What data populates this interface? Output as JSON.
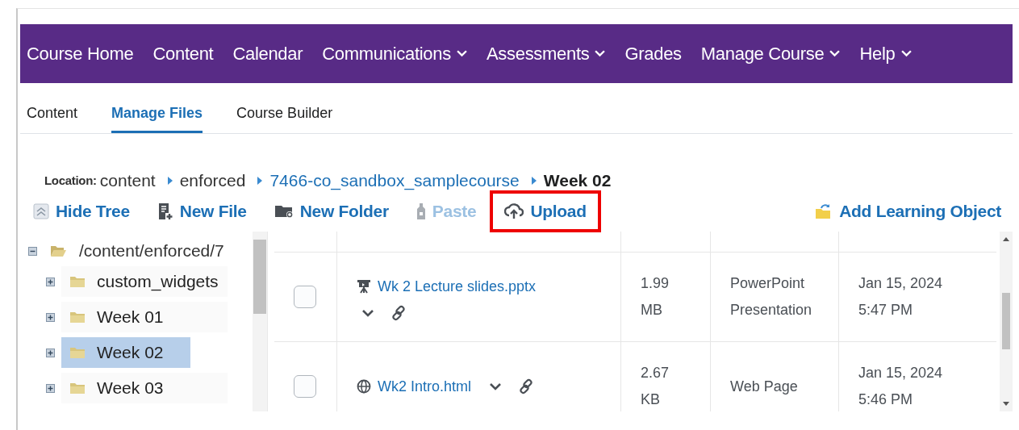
{
  "nav": [
    {
      "label": "Course Home",
      "dropdown": false
    },
    {
      "label": "Content",
      "dropdown": false
    },
    {
      "label": "Calendar",
      "dropdown": false
    },
    {
      "label": "Communications",
      "dropdown": true
    },
    {
      "label": "Assessments",
      "dropdown": true
    },
    {
      "label": "Grades",
      "dropdown": false
    },
    {
      "label": "Manage Course",
      "dropdown": true
    },
    {
      "label": "Help",
      "dropdown": true
    }
  ],
  "tabs": [
    {
      "label": "Content",
      "selected": false
    },
    {
      "label": "Manage Files",
      "selected": true
    },
    {
      "label": "Course Builder",
      "selected": false
    }
  ],
  "location": {
    "label": "Location:",
    "crumbs": [
      {
        "label": "content",
        "kind": "plain"
      },
      {
        "label": "enforced",
        "kind": "plain"
      },
      {
        "label": "7466-co_sandbox_samplecourse",
        "kind": "link"
      },
      {
        "label": "Week 02",
        "kind": "current"
      }
    ]
  },
  "toolbar": [
    {
      "label": "Hide Tree",
      "kind": "hide",
      "disabled": false,
      "highlighted": false
    },
    {
      "label": "New File",
      "kind": "file",
      "disabled": false,
      "highlighted": false
    },
    {
      "label": "New Folder",
      "kind": "folder",
      "disabled": false,
      "highlighted": false
    },
    {
      "label": "Paste",
      "kind": "paste",
      "disabled": true,
      "highlighted": false
    },
    {
      "label": "Upload",
      "kind": "upload",
      "disabled": false,
      "highlighted": true
    },
    {
      "label": "Add Learning Object",
      "kind": "learning",
      "disabled": false,
      "highlighted": false
    }
  ],
  "tree": {
    "label": "/content/enforced/7",
    "expanded": true,
    "children": [
      {
        "label": "custom_widgets",
        "expanded": false,
        "selected": false
      },
      {
        "label": "Week 01",
        "expanded": false,
        "selected": false
      },
      {
        "label": "Week 02",
        "expanded": false,
        "selected": true
      },
      {
        "label": "Week 03",
        "expanded": false,
        "selected": false
      }
    ]
  },
  "rows": [
    {
      "checked": false,
      "kind": "slides",
      "name": "Wk 2 Lecture slides.pptx",
      "size": "1.99 MB",
      "type": "PowerPoint Presentation",
      "date": "Jan 15, 2024",
      "time": "5:47 PM"
    },
    {
      "checked": false,
      "kind": "web",
      "name": "Wk2 Intro.html",
      "size": "2.67 KB",
      "type": "Web Page",
      "date": "Jan 15, 2024",
      "time": "5:46 PM"
    }
  ]
}
